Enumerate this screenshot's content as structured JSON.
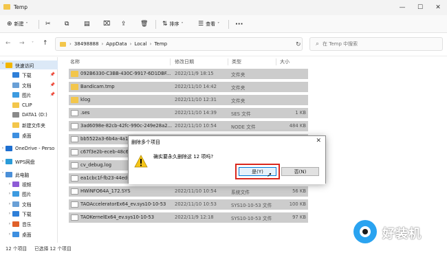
{
  "window": {
    "title": "Temp",
    "controls": [
      "—",
      "☐",
      "✕"
    ]
  },
  "toolbar": {
    "new_label": "新建",
    "sort_label": "排序",
    "view_label": "查看",
    "more_label": "···"
  },
  "address": {
    "crumbs": [
      "38498888",
      "AppData",
      "Local",
      "Temp"
    ],
    "search_placeholder": "在 Temp 中搜索"
  },
  "sidebar": {
    "items": [
      {
        "label": "快速访问",
        "icon": "star-icon",
        "expand": "˅",
        "pin": "",
        "color": "#f2b600"
      },
      {
        "label": "下载",
        "icon": "download-icon",
        "expand": "",
        "pin": "📌",
        "color": "#2f7fd8"
      },
      {
        "label": "文档",
        "icon": "document-icon",
        "expand": "",
        "pin": "📌",
        "color": "#6aa0d6"
      },
      {
        "label": "图片",
        "icon": "picture-icon",
        "expand": "",
        "pin": "📌",
        "color": "#3d9be0"
      },
      {
        "label": "CLIP",
        "icon": "folder-icon",
        "expand": "",
        "pin": "",
        "color": "#f3c64b"
      },
      {
        "label": "DATA1 (D:)",
        "icon": "drive-icon",
        "expand": "",
        "pin": "",
        "color": "#8a8a8a"
      },
      {
        "label": "新建文件夹",
        "icon": "folder-icon",
        "expand": "",
        "pin": "",
        "color": "#f3c64b"
      },
      {
        "label": "桌面",
        "icon": "desktop-icon",
        "expand": "",
        "pin": "",
        "color": "#3d8fe0"
      },
      {
        "label": "OneDrive - Perso",
        "icon": "cloud-icon",
        "expand": "›",
        "pin": "",
        "color": "#1e6fd0"
      },
      {
        "label": "WPS网盘",
        "icon": "cloud-icon",
        "expand": "›",
        "pin": "",
        "color": "#2a9bd8"
      },
      {
        "label": "此电脑",
        "icon": "computer-icon",
        "expand": "˅",
        "pin": "",
        "color": "#4a8fd8"
      },
      {
        "label": "视频",
        "icon": "video-icon",
        "expand": "›",
        "pin": "",
        "color": "#8e5bd6"
      },
      {
        "label": "图片",
        "icon": "picture-icon",
        "expand": "›",
        "pin": "",
        "color": "#3d9be0"
      },
      {
        "label": "文档",
        "icon": "document-icon",
        "expand": "›",
        "pin": "",
        "color": "#6aa0d6"
      },
      {
        "label": "下载",
        "icon": "download-icon",
        "expand": "›",
        "pin": "",
        "color": "#2f7fd8"
      },
      {
        "label": "音乐",
        "icon": "music-icon",
        "expand": "›",
        "pin": "",
        "color": "#e0602a"
      },
      {
        "label": "桌面",
        "icon": "desktop-icon",
        "expand": "›",
        "pin": "",
        "color": "#3d8fe0"
      }
    ]
  },
  "columns": {
    "name": "名称",
    "date": "修改日期",
    "type": "类型",
    "size": "大小"
  },
  "files": [
    {
      "name": "092B6330-C3BB-430C-9917-6D1DBF...",
      "date": "2022/11/9 18:15",
      "type": "文件夹",
      "size": "",
      "kind": "folder"
    },
    {
      "name": "Bandicam.tmp",
      "date": "2022/11/10 14:42",
      "type": "文件夹",
      "size": "",
      "kind": "folder"
    },
    {
      "name": "klog",
      "date": "2022/11/10 12:31",
      "type": "文件夹",
      "size": "",
      "kind": "folder"
    },
    {
      "name": ".ses",
      "date": "2022/11/10 14:39",
      "type": "SES 文件",
      "size": "1 KB",
      "kind": "file"
    },
    {
      "name": "3ad6098e-82cb-42fc-990c-249e28a2...",
      "date": "2022/11/10 10:54",
      "type": "NODE 文件",
      "size": "484 KB",
      "kind": "file"
    },
    {
      "name": "bb5522a3-6b4a-4a18",
      "date": "",
      "type": "",
      "size": "",
      "kind": "file"
    },
    {
      "name": "c67f3e2b-eceb-48c6",
      "date": "",
      "type": "",
      "size": "",
      "kind": "file"
    },
    {
      "name": "cv_debug.log",
      "date": "",
      "type": "",
      "size": "",
      "kind": "file"
    },
    {
      "name": "ea1cbc1f-fb23-44ed-",
      "date": "",
      "type": "",
      "size": "",
      "kind": "file"
    },
    {
      "name": "HWiNFO64A_172.SYS",
      "date": "2022/11/10 10:54",
      "type": "系统文件",
      "size": "56 KB",
      "kind": "file"
    },
    {
      "name": "TAOAcceleratorEx64_ev.sys10-10-53",
      "date": "2022/11/10 10:53",
      "type": "SYS10-10-53 文件",
      "size": "100 KB",
      "kind": "file"
    },
    {
      "name": "TAOKernelEx64_ev.sys10-10-53",
      "date": "2022/11/9 12:18",
      "type": "SYS10-10-53 文件",
      "size": "97 KB",
      "kind": "file"
    }
  ],
  "status": {
    "count": "12 个项目",
    "selected": "已选择 12 个项目"
  },
  "dialog": {
    "title": "删除多个项目",
    "message": "确实要永久删除这 12 项吗?",
    "yes_label": "是(Y)",
    "no_label": "否(N)",
    "close": "✕"
  },
  "watermark": {
    "text": "好装机"
  },
  "colors": {
    "selection": "#cccccc",
    "accent": "#0078d7",
    "highlight_box": "#d9261c"
  }
}
